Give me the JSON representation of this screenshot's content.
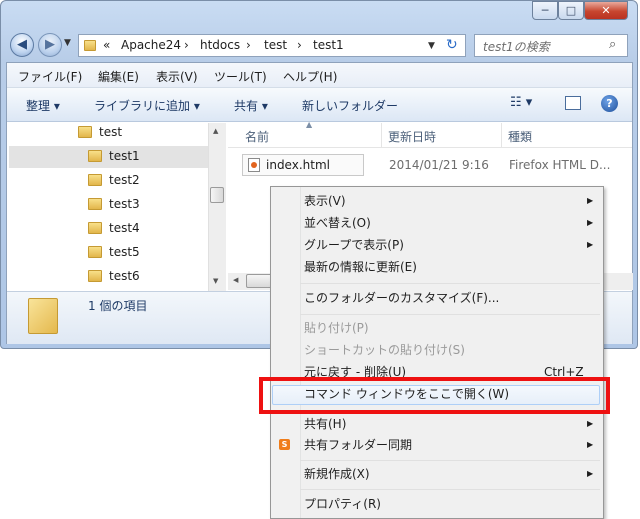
{
  "window": {
    "caption_minimize": "─",
    "caption_maximize": "□",
    "caption_close": "✕"
  },
  "address_bar": {
    "chevron": "«",
    "segments": [
      "Apache24",
      "htdocs",
      "test",
      "test1"
    ],
    "separator": "›",
    "search_placeholder": "test1の検索"
  },
  "menu_bar": {
    "items": [
      "ファイル(F)",
      "編集(E)",
      "表示(V)",
      "ツール(T)",
      "ヘルプ(H)"
    ]
  },
  "toolbar": {
    "organize": "整理",
    "add_to_library": "ライブラリに追加",
    "share": "共有",
    "new_folder": "新しいフォルダー",
    "help": "?"
  },
  "nav_pane": {
    "items": [
      "test",
      "test1",
      "test2",
      "test3",
      "test4",
      "test5",
      "test6"
    ],
    "selected": "test1"
  },
  "file_list": {
    "columns": [
      "名前",
      "更新日時",
      "種類"
    ],
    "rows": [
      {
        "name": "index.html",
        "modified": "2014/01/21 9:16",
        "type": "Firefox HTML D..."
      }
    ]
  },
  "details_pane": {
    "text": "1 個の項目"
  },
  "context_menu": {
    "items": [
      {
        "label": "表示(V)",
        "submenu": true,
        "disabled": false
      },
      {
        "label": "並べ替え(O)",
        "submenu": true,
        "disabled": false
      },
      {
        "label": "グループで表示(P)",
        "submenu": true,
        "disabled": false
      },
      {
        "label": "最新の情報に更新(E)",
        "submenu": false,
        "disabled": false
      },
      {
        "label": "このフォルダーのカスタマイズ(F)...",
        "submenu": false,
        "disabled": false
      },
      {
        "label": "貼り付け(P)",
        "submenu": false,
        "disabled": true
      },
      {
        "label": "ショートカットの貼り付け(S)",
        "submenu": false,
        "disabled": true
      },
      {
        "label": "元に戻す - 削除(U)",
        "shortcut": "Ctrl+Z",
        "submenu": false,
        "disabled": false
      },
      {
        "label": "コマンド ウィンドウをここで開く(W)",
        "submenu": false,
        "disabled": false,
        "highlighted": true
      },
      {
        "label": "共有(H)",
        "submenu": true,
        "disabled": false
      },
      {
        "label": "共有フォルダー同期",
        "submenu": true,
        "disabled": false
      },
      {
        "label": "新規作成(X)",
        "submenu": true,
        "disabled": false
      },
      {
        "label": "プロパティ(R)",
        "submenu": false,
        "disabled": false
      }
    ]
  },
  "colors": {
    "highlight_border": "#ee1111",
    "selection": "#e7eff9"
  }
}
